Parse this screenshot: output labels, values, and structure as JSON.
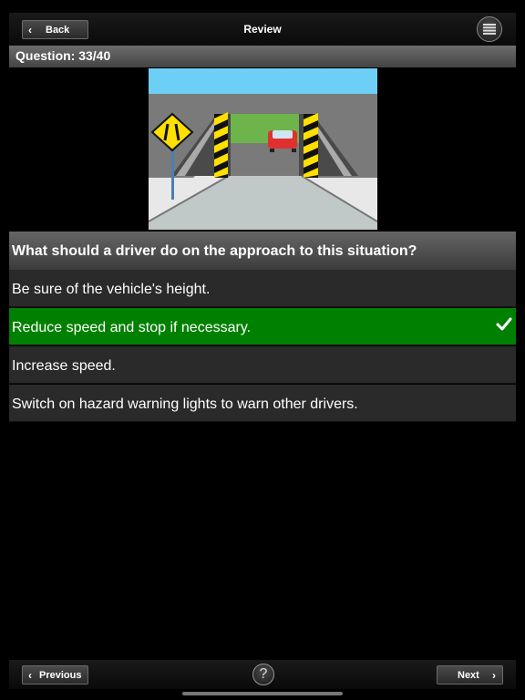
{
  "header": {
    "back_label": "Back",
    "title": "Review"
  },
  "question_counter": "Question: 33/40",
  "question": {
    "text": "What should a driver do on the approach to this situation?",
    "answers": [
      {
        "text": "Be sure of the vehicle's height.",
        "correct": false
      },
      {
        "text": "Reduce speed and stop if necessary.",
        "correct": true
      },
      {
        "text": "Increase speed.",
        "correct": false
      },
      {
        "text": "Switch on hazard warning lights to warn other drivers.",
        "correct": false
      }
    ]
  },
  "footer": {
    "previous_label": "Previous",
    "help_symbol": "?",
    "next_label": "Next"
  },
  "colors": {
    "correct": "#008000",
    "answer_bg": "#2a2a2a",
    "sign_yellow": "#ffe000",
    "sky": "#6ecff6"
  },
  "icons": {
    "back": "chevron-left-icon",
    "menu": "menu-icon",
    "check": "checkmark-icon",
    "help": "question-mark-icon",
    "next": "chevron-right-icon"
  }
}
